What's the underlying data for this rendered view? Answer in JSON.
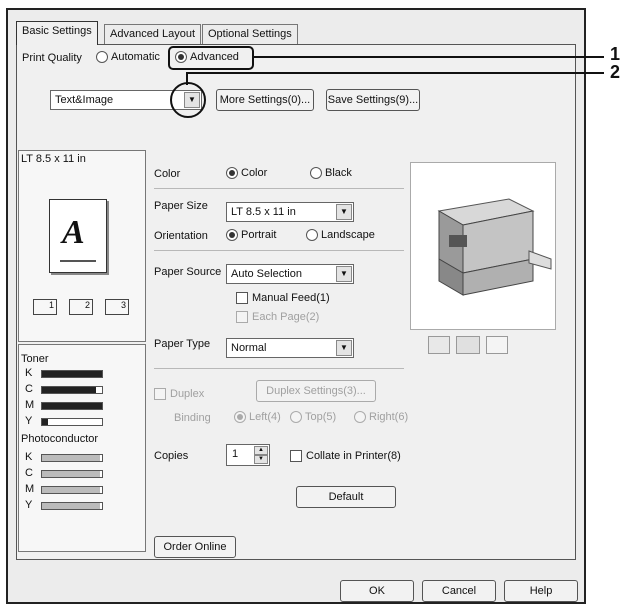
{
  "tabs": [
    {
      "label": "Basic Settings",
      "active": true
    },
    {
      "label": "Advanced Layout",
      "active": false
    },
    {
      "label": "Optional Settings",
      "active": false
    }
  ],
  "print_quality": {
    "label": "Print Quality",
    "options": [
      "Automatic",
      "Advanced"
    ],
    "selected": "Advanced"
  },
  "quality_mode": {
    "value": "Text&Image"
  },
  "top_buttons": {
    "more_settings": "More Settings(0)...",
    "save_settings": "Save Settings(9)..."
  },
  "paper_preview": {
    "size_label": "LT 8.5 x 11 in",
    "letter": "A",
    "copy_marks": [
      "1",
      "2",
      "3"
    ]
  },
  "color": {
    "label": "Color",
    "options": [
      "Color",
      "Black"
    ],
    "selected": "Color"
  },
  "paper_size": {
    "label": "Paper Size",
    "value": "LT 8.5 x 11 in"
  },
  "orientation": {
    "label": "Orientation",
    "options": [
      "Portrait",
      "Landscape"
    ],
    "selected": "Portrait"
  },
  "paper_source": {
    "label": "Paper Source",
    "value": "Auto Selection",
    "manual_feed": "Manual Feed(1)",
    "each_page": "Each Page(2)"
  },
  "paper_type": {
    "label": "Paper Type",
    "value": "Normal"
  },
  "duplex": {
    "label": "Duplex",
    "settings_button": "Duplex Settings(3)...",
    "binding_label": "Binding",
    "binding_options": [
      "Left(4)",
      "Top(5)",
      "Right(6)"
    ],
    "binding_selected": "Left(4)"
  },
  "copies": {
    "label": "Copies",
    "value": "1",
    "collate": "Collate in Printer(8)"
  },
  "default_button": "Default",
  "order_online": "Order Online",
  "toner": {
    "title": "Toner",
    "levels": [
      {
        "name": "K",
        "level": 1.0
      },
      {
        "name": "C",
        "level": 0.9
      },
      {
        "name": "M",
        "level": 1.0
      },
      {
        "name": "Y",
        "level": 0.1
      }
    ]
  },
  "photoconductor": {
    "title": "Photoconductor",
    "items": [
      "K",
      "C",
      "M",
      "Y"
    ]
  },
  "footer": {
    "ok": "OK",
    "cancel": "Cancel",
    "help": "Help"
  },
  "callouts": [
    "1",
    "2"
  ]
}
